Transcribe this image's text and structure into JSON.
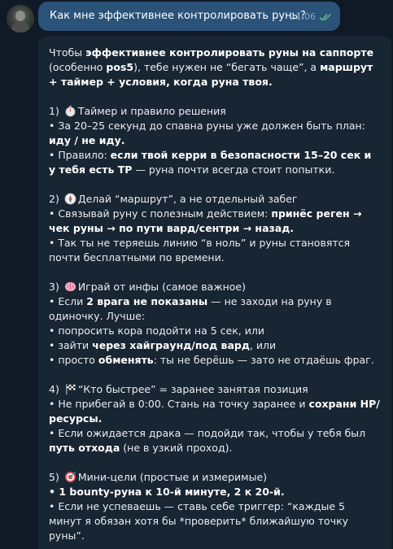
{
  "outgoing": {
    "text": "Как мне эффективнее контролировать руны?",
    "time": "21:06",
    "status_icon": "double-check-icon"
  },
  "incoming": {
    "intro": [
      {
        "t": "Чтобы ",
        "b": false
      },
      {
        "t": "эффективнее контролировать руны на саппорте",
        "b": true
      },
      {
        "t": " (особенно ",
        "b": false
      },
      {
        "t": "pos5",
        "b": true
      },
      {
        "t": "), тебе нужен не “бегать чаще”, а ",
        "b": false
      },
      {
        "t": "маршрут + таймер + условия, когда руна твоя.",
        "b": true
      }
    ],
    "s1_head": "1) ",
    "s1_icon": "stopwatch-icon",
    "s1_title": "Таймер и правило решения",
    "s1_l1a": "• За 20–25 секунд до спавна руны уже должен быть план: ",
    "s1_l1b": "иду / не иду.",
    "s1_l2a": "• Правило: ",
    "s1_l2b": "если твой керри в безопасности 15–20 сек и у тебя есть ТР",
    "s1_l2c": " — руна почти всегда стоит попытки.",
    "s2_head": "2) ",
    "s2_icon": "compass-icon",
    "s2_title": "Делай “маршрут”, а не отдельный забег",
    "s2_l1a": "• Связывай руну с полезным действием: ",
    "s2_l1b": "принёс реген → чек руны → по пути вард/сентри → назад.",
    "s2_l2": "• Так ты не теряешь линию “в ноль” и руны становятся почти бесплатными по времени.",
    "s3_head": "3) ",
    "s3_icon": "brain-icon",
    "s3_title": "Играй от инфы (самое важное)",
    "s3_l1a": "• Если ",
    "s3_l1b": "2 врага не показаны",
    "s3_l1c": " — не заходи на руну в одиночку. Лучше:",
    "s3_l2": "• попросить кора подойти на 5 сек, или",
    "s3_l3a": "• зайти ",
    "s3_l3b": "через хайграунд/под вард",
    "s3_l3c": ", или",
    "s3_l4a": "• просто ",
    "s3_l4b": "обменять",
    "s3_l4c": ": ты не берёшь — зато не отдаёшь фраг.",
    "s4_head": "4) ",
    "s4_icon": "checkered-flag-icon",
    "s4_title": "“Кто быстрее” = заранее занятая позиция",
    "s4_l1a": "• Не прибегай в 0:00. Стань на точку заранее и ",
    "s4_l1b": "сохрани HP/ресурсы.",
    "s4_l2a": "• Если ожидается драка — подойди так, чтобы у тебя был ",
    "s4_l2b": "путь отхода",
    "s4_l2c": " (не в узкий проход).",
    "s5_head": "5) ",
    "s5_icon": "target-icon",
    "s5_title": "Мини-цели (простые и измеримые)",
    "s5_l1": "• 1 bounty-руна к 10-й минуте, 2 к 20-й.",
    "s5_l2": "• Если не успеваешь — ставь себе триггер: “каждые 5 минут я обязан хотя бы *проверить* ближайшую точку руны”."
  },
  "colors": {
    "outgoing_bubble": "#2b5278",
    "incoming_bubble": "#182533",
    "background": "#0f1a26",
    "check_color": "#5fbf8f"
  }
}
